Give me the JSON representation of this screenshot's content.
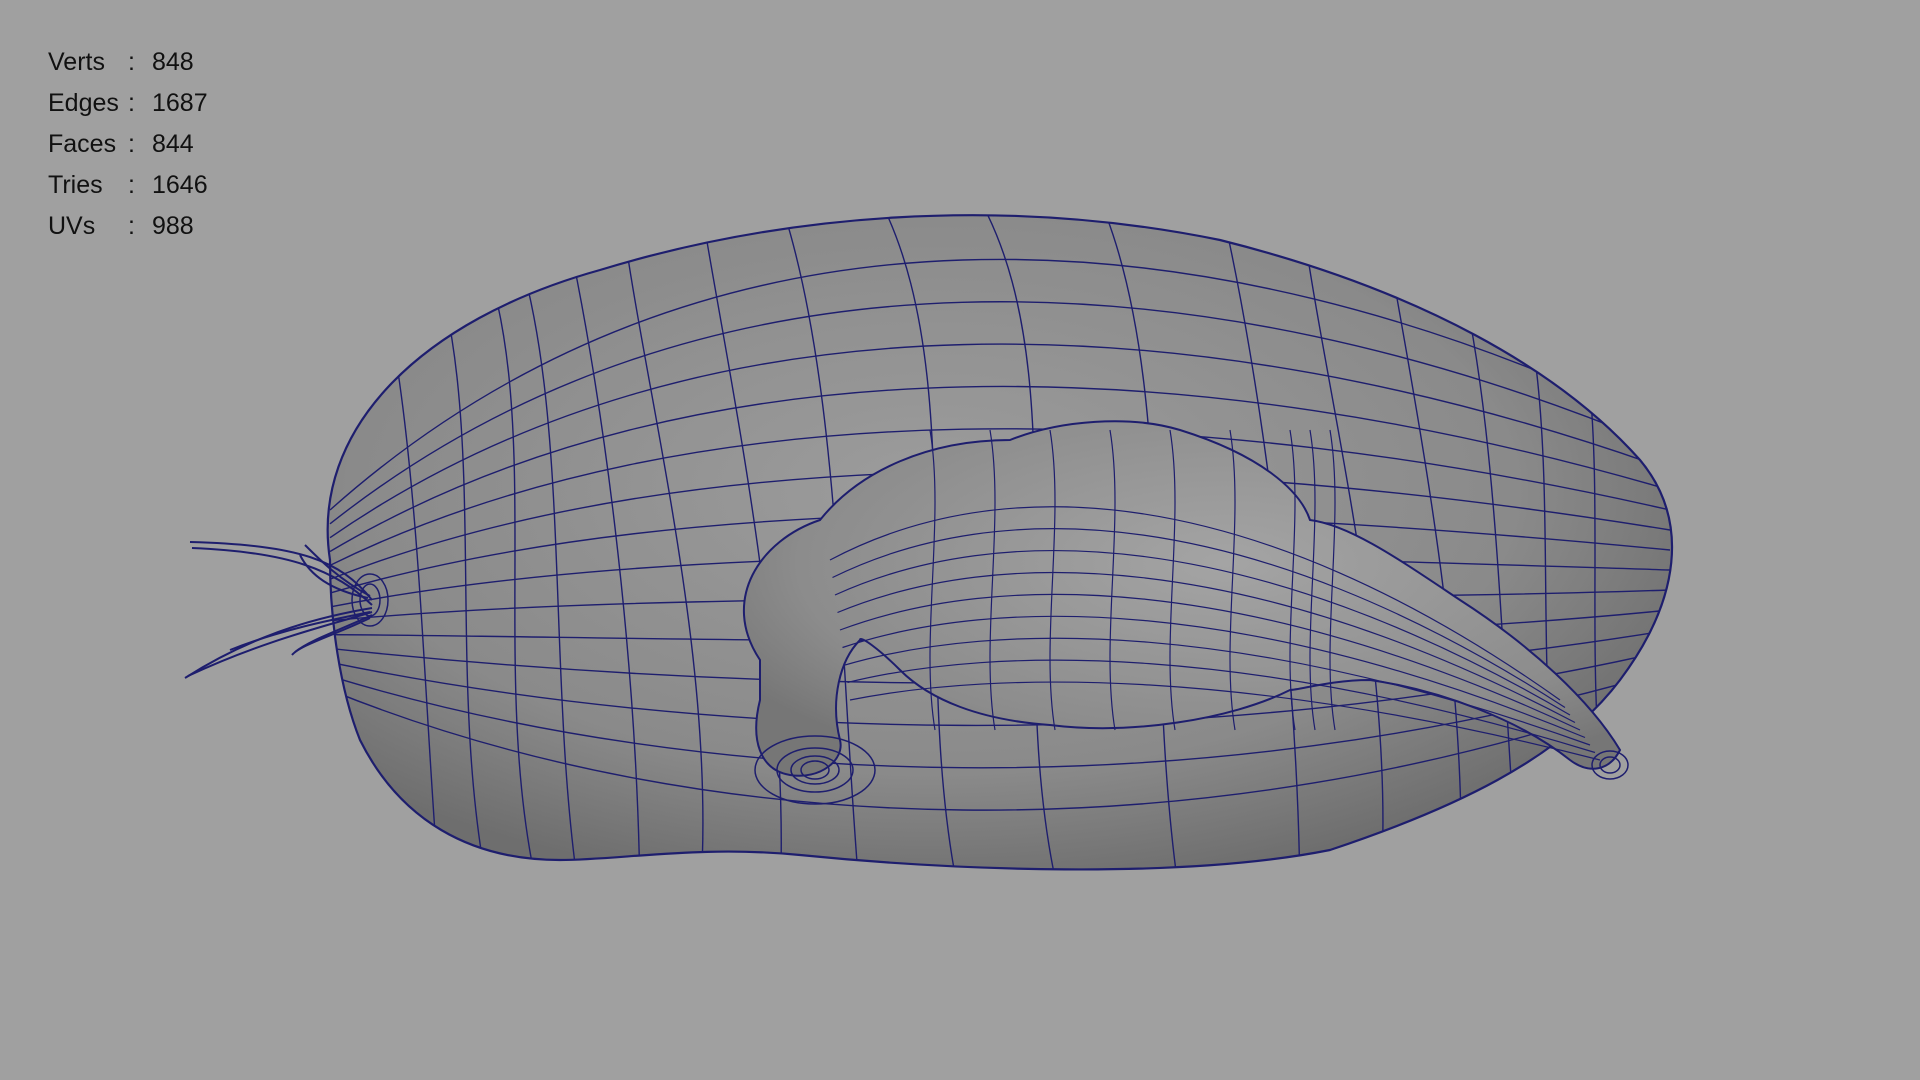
{
  "viewport": {
    "background_color": "#a0a0a0",
    "wire_color": "#1e1e6e"
  },
  "heads_up_display": {
    "stats": [
      {
        "label": "Verts",
        "separator": ":",
        "value": "848"
      },
      {
        "label": "Edges",
        "separator": ":",
        "value": "1687"
      },
      {
        "label": "Faces",
        "separator": ":",
        "value": "844"
      },
      {
        "label": "Tries",
        "separator": ":",
        "value": "1646"
      },
      {
        "label": "UVs",
        "separator": ":",
        "value": "988"
      }
    ]
  }
}
